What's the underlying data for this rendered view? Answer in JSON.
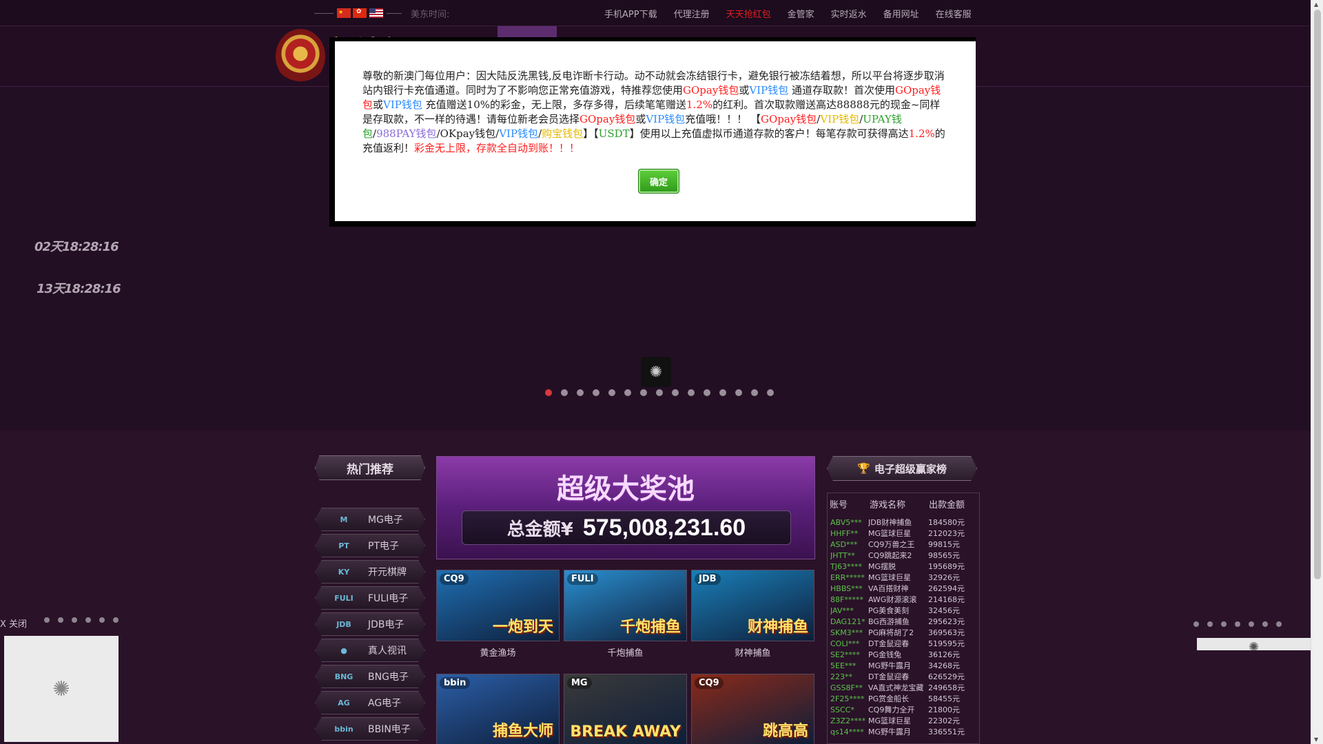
{
  "topbar": {
    "us_time_label": "美东时间:",
    "nav": [
      {
        "label": "手机APP下载",
        "hot": false
      },
      {
        "label": "代理注册",
        "hot": false
      },
      {
        "label": "天天抢红包",
        "hot": true
      },
      {
        "label": "金管家",
        "hot": false
      },
      {
        "label": "实时返水",
        "hot": false
      },
      {
        "label": "备用网址",
        "hot": false
      },
      {
        "label": "在线客服",
        "hot": false
      }
    ]
  },
  "header": {
    "logo_text": "新澳门"
  },
  "countdowns": [
    "02天18:28:16",
    "13天18:28:16"
  ],
  "banner": {
    "dot_count": 15,
    "active_index": 0
  },
  "hot": {
    "title": "热门推荐"
  },
  "categories": [
    {
      "icon": "mg-icon",
      "glyph": "M",
      "label": "MG电子"
    },
    {
      "icon": "pt-icon",
      "glyph": "PT",
      "label": "PT电子"
    },
    {
      "icon": "ky-icon",
      "glyph": "KY",
      "label": "开元棋牌"
    },
    {
      "icon": "fuli-icon",
      "glyph": "FULI",
      "label": "FULI电子"
    },
    {
      "icon": "jdb-icon",
      "glyph": "JDB",
      "label": "JDB电子"
    },
    {
      "icon": "dealer-icon",
      "glyph": "●",
      "label": "真人视讯"
    },
    {
      "icon": "bng-icon",
      "glyph": "BNG",
      "label": "BNG电子"
    },
    {
      "icon": "ag-icon",
      "glyph": "AG",
      "label": "AG电子"
    },
    {
      "icon": "bbin-icon",
      "glyph": "bbin",
      "label": "BBIN电子"
    }
  ],
  "jackpot": {
    "title": "超级大奖池",
    "label": "总金额¥",
    "amount": "575,008,231.60"
  },
  "games": [
    {
      "brand": "CQ9",
      "art": "一炮到天",
      "name": "黄金渔场",
      "color": "#1f6fb3"
    },
    {
      "brand": "FULI",
      "art": "千炮捕鱼",
      "name": "千炮捕鱼",
      "color": "#2a8fd0"
    },
    {
      "brand": "JDB",
      "art": "财神捕鱼",
      "name": "财神捕鱼",
      "color": "#1a7fb8"
    },
    {
      "brand": "bbin",
      "art": "捕鱼大师",
      "name": "",
      "color": "#2b5fa8"
    },
    {
      "brand": "MG",
      "art": "BREAK AWAY",
      "name": "",
      "color": "#3a3a3a"
    },
    {
      "brand": "CQ9",
      "art": "跳高高",
      "name": "",
      "color": "#8a2a1a"
    }
  ],
  "winners": {
    "title": "电子超级赢家榜",
    "headers": [
      "账号",
      "游戏名称",
      "出款金额"
    ],
    "rows": [
      [
        "ABV5***",
        "JDB财神捕鱼",
        "184580元"
      ],
      [
        "HHFF**",
        "MG篮球巨星",
        "212023元"
      ],
      [
        "ASD***",
        "CQ9万兽之王",
        "99815元"
      ],
      [
        "JHTT**",
        "CQ9跳起来2",
        "98565元"
      ],
      [
        "TJ63****",
        "MG摆脱",
        "195689元"
      ],
      [
        "ERR*****",
        "MG篮球巨星",
        "32926元"
      ],
      [
        "HBBS***",
        "VA百搭财神",
        "262594元"
      ],
      [
        "88F*****",
        "AWG财源滚滚",
        "214168元"
      ],
      [
        "JAV***",
        "PG美食美刻",
        "32456元"
      ],
      [
        "DAG121*",
        "BG西游捕鱼",
        "295623元"
      ],
      [
        "SKM3***",
        "PG麻将胡了2",
        "369563元"
      ],
      [
        "COLI***",
        "DT金鼠迎春",
        "519595元"
      ],
      [
        "SE2****",
        "PG金钱兔",
        "36126元"
      ],
      [
        "5EE***",
        "MG野牛露月",
        "34268元"
      ],
      [
        "223**",
        "DT金鼠迎春",
        "626529元"
      ],
      [
        "GSS8F**",
        "VA直式神龙宝藏",
        "249658元"
      ],
      [
        "2F25****",
        "PG赏金船长",
        "58455元"
      ],
      [
        "SSCC*",
        "CQ9舞力全开",
        "21800元"
      ],
      [
        "Z3Z2****",
        "MG篮球巨星",
        "22302元"
      ],
      [
        "qs14****",
        "MG野牛露月",
        "336551元"
      ]
    ]
  },
  "left_ad": {
    "close_label": "X 关闭",
    "dot_count": 6
  },
  "right_ad": {
    "dot_count": 7
  },
  "modal": {
    "confirm_label": "确定",
    "segments": [
      {
        "c": "dark",
        "t": "尊敬的新澳门每位用户：因大陆反洗黑钱,反电诈断卡行动。动不动就会冻结银行卡，避免银行被冻结着想，所以平台将逐步取消站内银行卡充值通道。同时为了不影响您正常充值游戏，特推荐您使用"
      },
      {
        "c": "red",
        "t": "GOpay钱包"
      },
      {
        "c": "dark",
        "t": "或"
      },
      {
        "c": "blue",
        "t": "VIP钱包"
      },
      {
        "c": "dark",
        "t": "  通道存取款！首次使用"
      },
      {
        "c": "red",
        "t": "GOpay钱包"
      },
      {
        "c": "dark",
        "t": "或"
      },
      {
        "c": "blue",
        "t": "VIP钱包"
      },
      {
        "c": "dark",
        "t": "  充值赠送10%的彩金，无上限，多存多得，后续笔笔赠送"
      },
      {
        "c": "red",
        "t": "1.2%"
      },
      {
        "c": "dark",
        "t": "的红利。首次取款赠送高达88888元的现金~同样是存取款，不一样的待遇！请每位新老会员选择"
      },
      {
        "c": "red",
        "t": "GOpay钱包"
      },
      {
        "c": "dark",
        "t": "或"
      },
      {
        "c": "blue",
        "t": "VIP钱包"
      },
      {
        "c": "dark",
        "t": "充值哦！！！  【"
      },
      {
        "c": "red",
        "t": "GOpay钱包"
      },
      {
        "c": "dark",
        "t": "/"
      },
      {
        "c": "yellow",
        "t": "VIP钱包"
      },
      {
        "c": "dark",
        "t": "/"
      },
      {
        "c": "green",
        "t": "UPAY钱包"
      },
      {
        "c": "dark",
        "t": "/"
      },
      {
        "c": "purple",
        "t": "988PAY钱包"
      },
      {
        "c": "dark",
        "t": "/"
      },
      {
        "c": "dark",
        "t": "OKpay钱包"
      },
      {
        "c": "dark",
        "t": "/"
      },
      {
        "c": "blue",
        "t": "VIP钱包"
      },
      {
        "c": "dark",
        "t": "/"
      },
      {
        "c": "yellow",
        "t": "购宝钱包"
      },
      {
        "c": "dark",
        "t": "】【"
      },
      {
        "c": "green",
        "t": "USDT"
      },
      {
        "c": "dark",
        "t": "】使用以上充值虚拟币通道存款的客户！每笔存款可获得高达"
      },
      {
        "c": "red",
        "t": "1.2%"
      },
      {
        "c": "dark",
        "t": "的充值返利！"
      },
      {
        "c": "red",
        "t": "彩金无上限，存款全自动到账！！！"
      }
    ]
  }
}
